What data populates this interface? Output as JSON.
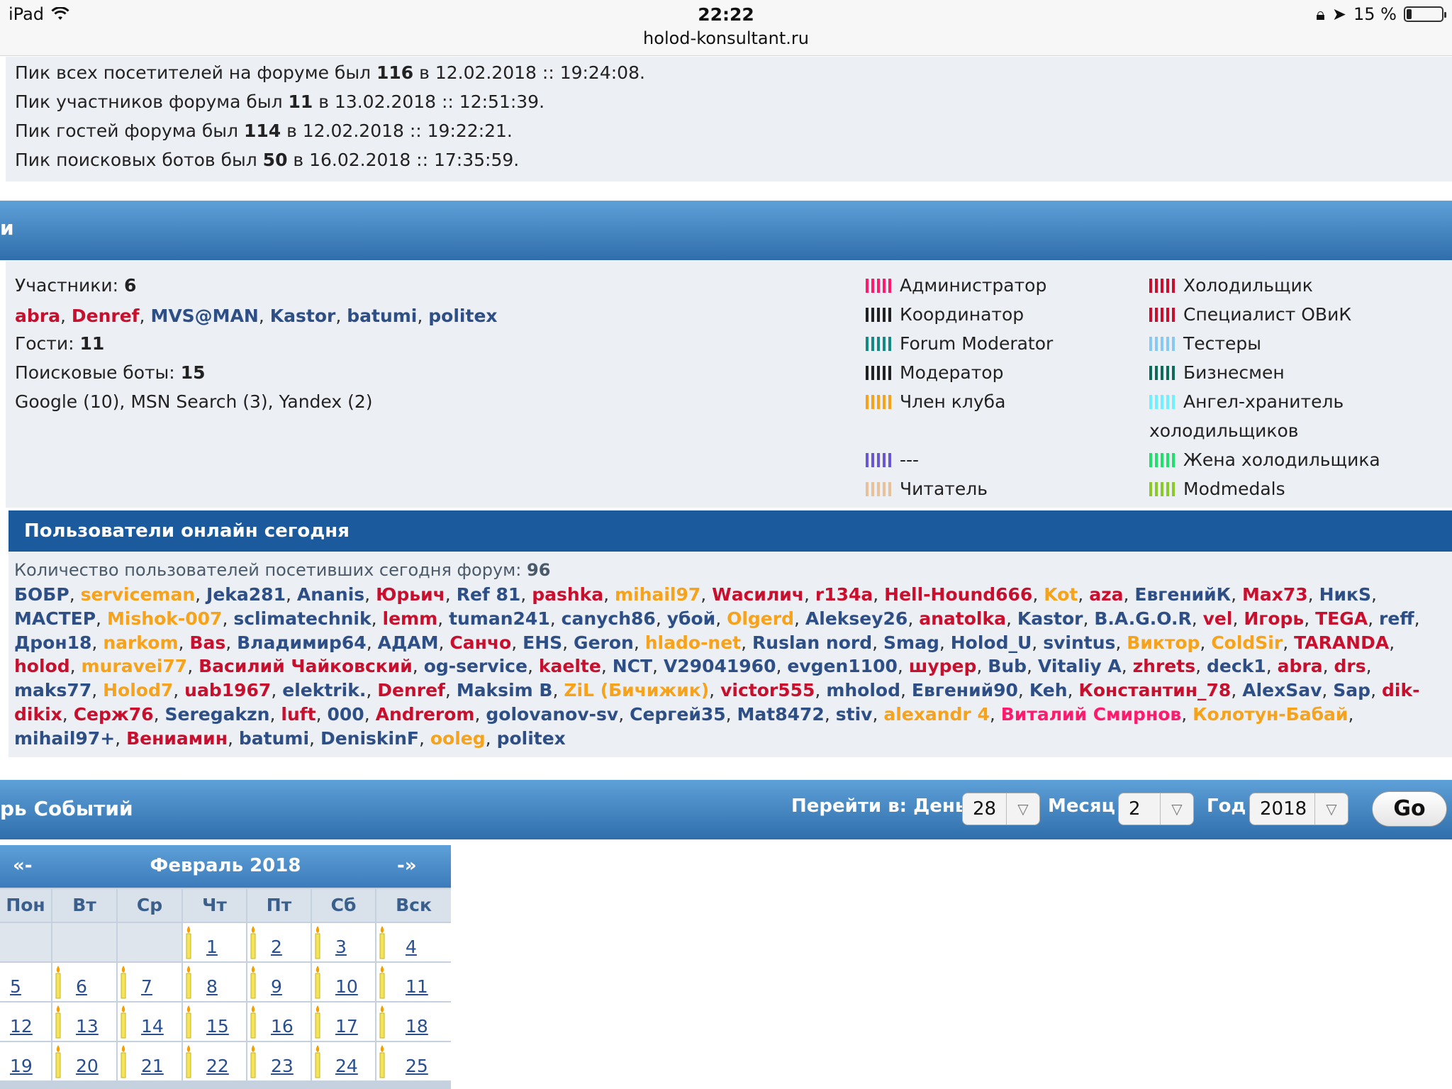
{
  "status_bar": {
    "device": "iPad",
    "time": "22:22",
    "url": "holod-konsultant.ru",
    "battery": "15 %",
    "battery_level": 0.15
  },
  "records": [
    {
      "pre": "Пик всех посетителей на форуме был ",
      "num": "116",
      "post": " в 12.02.2018 :: 19:24:08."
    },
    {
      "pre": "Пик участников форума был ",
      "num": "11",
      "post": " в 13.02.2018 :: 12:51:39."
    },
    {
      "pre": "Пик гостей форума был ",
      "num": "114",
      "post": " в 12.02.2018 :: 19:22:21."
    },
    {
      "pre": "Пик поисковых ботов был ",
      "num": "50",
      "post": " в 16.02.2018 :: 17:35:59."
    }
  ],
  "online": {
    "header_fragment": "и",
    "members_label": "Участники:",
    "members_count": "6",
    "members": [
      {
        "name": "abra",
        "color": "#c8102e"
      },
      {
        "name": "Denref",
        "color": "#c8102e"
      },
      {
        "name": "MVS@MAN",
        "color": "#2e4f86"
      },
      {
        "name": "Kastor",
        "color": "#2e4f86"
      },
      {
        "name": "batumi",
        "color": "#2e4f86"
      },
      {
        "name": "politex",
        "color": "#2e4f86"
      }
    ],
    "guests_label": "Гости:",
    "guests_count": "11",
    "bots_label": "Поисковые боты:",
    "bots_count": "15",
    "bots_list": "Google (10), MSN Search (3), Yandex (2)"
  },
  "legend": [
    {
      "label": "Администратор",
      "color": "#ff1a6e"
    },
    {
      "label": "Холодильщик",
      "color": "#c8102e"
    },
    {
      "label": "Координатор",
      "color": "#222222"
    },
    {
      "label": "Специалист ОВиК",
      "color": "#c8102e"
    },
    {
      "label": "Forum Moderator",
      "color": "#138a84"
    },
    {
      "label": "Тестеры",
      "color": "#87c9f5"
    },
    {
      "label": "Модератор",
      "color": "#222222"
    },
    {
      "label": "Бизнесмен",
      "color": "#0d6b5a"
    },
    {
      "label": "Член клуба",
      "color": "#f7a21b"
    },
    {
      "label": "Ангел-хранитель",
      "label2": "холодильщиков",
      "color": "#6ef0ff"
    },
    {
      "label": "---",
      "color": "#6a57d6"
    },
    {
      "label": "Жена холодильщика",
      "color": "#1ee06a"
    },
    {
      "label": "Читатель",
      "color": "#e8c09a"
    },
    {
      "label": "Modmedals",
      "color": "#8ac926"
    }
  ],
  "today": {
    "title": "Пользователи онлайн сегодня",
    "count_label": "Количество пользователей посетивших сегодня форум:",
    "count": "96",
    "users": [
      {
        "n": "БОБР",
        "c": "#2e4f86"
      },
      {
        "n": "serviceman",
        "c": "#f7a21b"
      },
      {
        "n": "Jeka281",
        "c": "#2e4f86"
      },
      {
        "n": "Ananis",
        "c": "#2e4f86"
      },
      {
        "n": "Юрьич",
        "c": "#c8102e"
      },
      {
        "n": "Ref 81",
        "c": "#2e4f86"
      },
      {
        "n": "pashka",
        "c": "#c8102e"
      },
      {
        "n": "mihail97",
        "c": "#f7a21b"
      },
      {
        "n": "Wасилич",
        "c": "#c8102e"
      },
      {
        "n": "r134a",
        "c": "#c8102e"
      },
      {
        "n": "Hell-Hound666",
        "c": "#c8102e"
      },
      {
        "n": "Kot",
        "c": "#f7a21b"
      },
      {
        "n": "aza",
        "c": "#c8102e"
      },
      {
        "n": "ЕвгенийК",
        "c": "#2e4f86"
      },
      {
        "n": "Max73",
        "c": "#c8102e"
      },
      {
        "n": "НикS",
        "c": "#2e4f86"
      },
      {
        "n": "МАСТЕР",
        "c": "#2e4f86"
      },
      {
        "n": "Mishok-007",
        "c": "#f7a21b"
      },
      {
        "n": "sclimatechnik",
        "c": "#2e4f86"
      },
      {
        "n": "lemm",
        "c": "#c8102e"
      },
      {
        "n": "tuman241",
        "c": "#2e4f86"
      },
      {
        "n": "canych86",
        "c": "#2e4f86"
      },
      {
        "n": "убой",
        "c": "#2e4f86"
      },
      {
        "n": "Olgerd",
        "c": "#f7a21b"
      },
      {
        "n": "Aleksey26",
        "c": "#2e4f86"
      },
      {
        "n": "anatolka",
        "c": "#c8102e"
      },
      {
        "n": "Kastor",
        "c": "#2e4f86"
      },
      {
        "n": "B.A.G.O.R",
        "c": "#2e4f86"
      },
      {
        "n": "vel",
        "c": "#c8102e"
      },
      {
        "n": "Игорь",
        "c": "#c8102e"
      },
      {
        "n": "TEGA",
        "c": "#c8102e"
      },
      {
        "n": "reff",
        "c": "#2e4f86"
      },
      {
        "n": "Дрон18",
        "c": "#2e4f86"
      },
      {
        "n": "narkom",
        "c": "#f7a21b"
      },
      {
        "n": "Bas",
        "c": "#c8102e"
      },
      {
        "n": "Владимир64",
        "c": "#2e4f86"
      },
      {
        "n": "АДАМ",
        "c": "#2e4f86"
      },
      {
        "n": "Санчо",
        "c": "#c8102e"
      },
      {
        "n": "EHS",
        "c": "#2e4f86"
      },
      {
        "n": "Geron",
        "c": "#2e4f86"
      },
      {
        "n": "hlado-net",
        "c": "#f7a21b"
      },
      {
        "n": "Ruslan nord",
        "c": "#2e4f86"
      },
      {
        "n": "Smag",
        "c": "#2e4f86"
      },
      {
        "n": "Holod_U",
        "c": "#2e4f86"
      },
      {
        "n": "svintus",
        "c": "#2e4f86"
      },
      {
        "n": "Виктор",
        "c": "#f7a21b"
      },
      {
        "n": "ColdSir",
        "c": "#f7a21b"
      },
      {
        "n": "TARANDA",
        "c": "#c8102e"
      },
      {
        "n": "holod",
        "c": "#c8102e"
      },
      {
        "n": "muravei77",
        "c": "#f7a21b"
      },
      {
        "n": "Василий Чайковский",
        "c": "#c8102e"
      },
      {
        "n": "og-service",
        "c": "#2e4f86"
      },
      {
        "n": "kaelte",
        "c": "#c8102e"
      },
      {
        "n": "NCT",
        "c": "#2e4f86"
      },
      {
        "n": "V29041960",
        "c": "#2e4f86"
      },
      {
        "n": "evgen1100",
        "c": "#2e4f86"
      },
      {
        "n": "шурер",
        "c": "#c8102e"
      },
      {
        "n": "Bub",
        "c": "#2e4f86"
      },
      {
        "n": "Vitaliy A",
        "c": "#2e4f86"
      },
      {
        "n": "zhrets",
        "c": "#c8102e"
      },
      {
        "n": "deck1",
        "c": "#2e4f86"
      },
      {
        "n": "abra",
        "c": "#c8102e"
      },
      {
        "n": "drs",
        "c": "#c8102e"
      },
      {
        "n": "maks77",
        "c": "#2e4f86"
      },
      {
        "n": "Holod7",
        "c": "#f7a21b"
      },
      {
        "n": "uab1967",
        "c": "#c8102e"
      },
      {
        "n": "elektrik.",
        "c": "#2e4f86"
      },
      {
        "n": "Denref",
        "c": "#c8102e"
      },
      {
        "n": "Maksim B",
        "c": "#2e4f86"
      },
      {
        "n": "ZiL (Бичижик)",
        "c": "#f7a21b"
      },
      {
        "n": "victor555",
        "c": "#c8102e"
      },
      {
        "n": "mholod",
        "c": "#2e4f86"
      },
      {
        "n": "Евгений90",
        "c": "#2e4f86"
      },
      {
        "n": "Keh",
        "c": "#2e4f86"
      },
      {
        "n": "Константин_78",
        "c": "#c8102e"
      },
      {
        "n": "AlexSav",
        "c": "#2e4f86"
      },
      {
        "n": "Sap",
        "c": "#2e4f86"
      },
      {
        "n": "dik-dikix",
        "c": "#c8102e"
      },
      {
        "n": "Серж76",
        "c": "#c8102e"
      },
      {
        "n": "Seregakzn",
        "c": "#2e4f86"
      },
      {
        "n": "luft",
        "c": "#c8102e"
      },
      {
        "n": "000",
        "c": "#2e4f86"
      },
      {
        "n": "Andrerom",
        "c": "#c8102e"
      },
      {
        "n": "golovanov-sv",
        "c": "#2e4f86"
      },
      {
        "n": "Сергей35",
        "c": "#2e4f86"
      },
      {
        "n": "Mat8472",
        "c": "#2e4f86"
      },
      {
        "n": "stiv",
        "c": "#2e4f86"
      },
      {
        "n": "alexandr 4",
        "c": "#f7a21b"
      },
      {
        "n": "Виталий Смирнов",
        "c": "#ff1a6e"
      },
      {
        "n": "Колотун-Бабай",
        "c": "#f7a21b"
      },
      {
        "n": "mihail97+",
        "c": "#2e4f86"
      },
      {
        "n": "Вениамин",
        "c": "#c8102e"
      },
      {
        "n": "batumi",
        "c": "#2e4f86"
      },
      {
        "n": "DeniskinF",
        "c": "#2e4f86"
      },
      {
        "n": "ooleg",
        "c": "#f7a21b"
      },
      {
        "n": "politex",
        "c": "#2e4f86"
      }
    ]
  },
  "calendar_bar": {
    "title": "рь Событий",
    "jump_label": "Перейти в: День",
    "day_value": "28",
    "month_label": "Месяц",
    "month_value": "2",
    "year_label": "Год",
    "year_value": "2018",
    "go_label": "Go"
  },
  "calendar": {
    "prev": "«-",
    "next": "-»",
    "month": "Февраль 2018",
    "weekdays": [
      "Пон",
      "Вт",
      "Ср",
      "Чт",
      "Пт",
      "Сб",
      "Вск"
    ],
    "weeks": [
      [
        "",
        "",
        "",
        "1",
        "2",
        "3",
        "4"
      ],
      [
        "5",
        "6",
        "7",
        "8",
        "9",
        "10",
        "11"
      ],
      [
        "12",
        "13",
        "14",
        "15",
        "16",
        "17",
        "18"
      ],
      [
        "19",
        "20",
        "21",
        "22",
        "23",
        "24",
        "25"
      ]
    ]
  }
}
